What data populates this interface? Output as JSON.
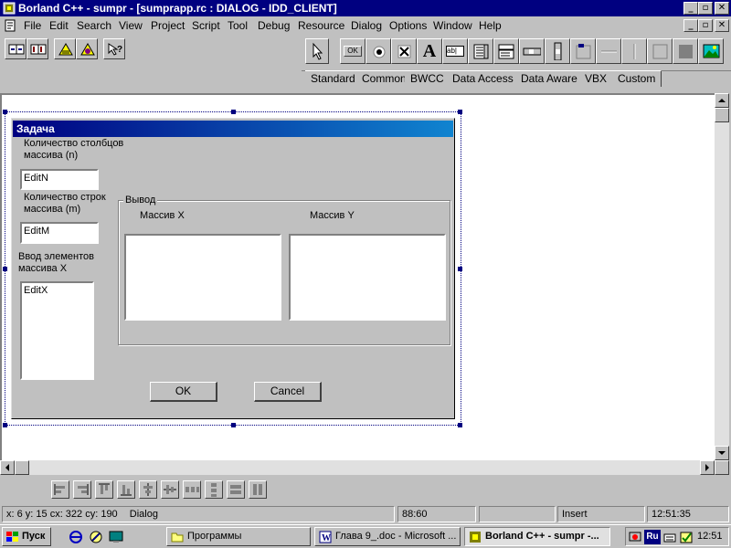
{
  "window": {
    "title": "Borland C++ - sumpr - [sumprapp.rc : DIALOG - IDD_CLIENT]",
    "min": "_",
    "max": "▫",
    "close": "✕"
  },
  "menu": [
    "File",
    "Edit",
    "Search",
    "View",
    "Project",
    "Script",
    "Tool",
    "Debug",
    "Resource",
    "Dialog",
    "Options",
    "Window",
    "Help"
  ],
  "palette_tabs": [
    "Standard",
    "Common",
    "BWCC",
    "Data Access",
    "Data Aware",
    "VBX",
    "Custom"
  ],
  "palette_ok_label": "OK",
  "palette_text_label": "A",
  "palette_edit_label": "ab|",
  "dialog": {
    "title": "Задача",
    "label_n": "Количество столбцов\nмассива (n)",
    "edit_n": "EditN",
    "label_m": "Количество строк\nмассива (m)",
    "edit_m": "EditM",
    "label_x": "Ввод элементов\nмассива X",
    "edit_x": "EditX",
    "group_title": "Вывод",
    "col_x": "Массив X",
    "col_y": "Массив Y",
    "ok": "OK",
    "cancel": "Cancel"
  },
  "status": {
    "coords": "x: 6  y: 15  cx: 322  cy: 190",
    "mode": "Dialog",
    "position": "88:60",
    "insert": "Insert",
    "time": "12:51:35"
  },
  "taskbar": {
    "start": "Пуск",
    "tasks": [
      "Программы",
      "Глава 9_.doc - Microsoft ...",
      "Borland C++ - sumpr -..."
    ],
    "lang": "Ru",
    "clock": "12:51"
  }
}
